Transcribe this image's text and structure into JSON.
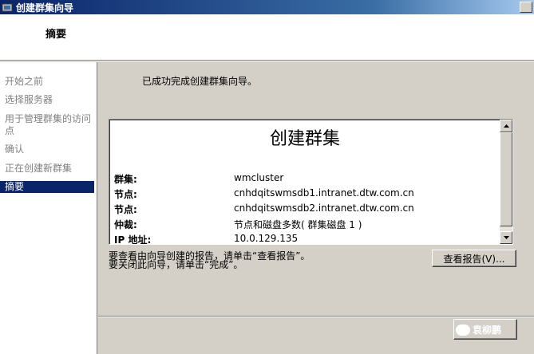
{
  "window": {
    "title": "创建群集向导"
  },
  "header": {
    "title": "摘要"
  },
  "sidebar": {
    "items": [
      {
        "label": "开始之前",
        "active": false
      },
      {
        "label": "选择服务器",
        "active": false
      },
      {
        "label": "用于管理群集的访问点",
        "active": false
      },
      {
        "label": "确认",
        "active": false
      },
      {
        "label": "正在创建新群集",
        "active": false
      },
      {
        "label": "摘要",
        "active": true
      }
    ]
  },
  "main": {
    "success_message": "已成功完成创建群集向导。",
    "report": {
      "title": "创建群集",
      "rows": [
        {
          "label": "群集:",
          "value": "wmcluster"
        },
        {
          "label": "节点:",
          "value": "cnhdqitswmsdb1.intranet.dtw.com.cn"
        },
        {
          "label": "节点:",
          "value": "cnhdqitswmsdb2.intranet.dtw.com.cn"
        },
        {
          "label": "仲裁:",
          "value": "节点和磁盘多数( 群集磁盘 1 )"
        },
        {
          "label": "IP 地址:",
          "value": "10.0.129.135"
        }
      ]
    },
    "hint_line1": "要查看由向导创建的报告，请单击“查看报告”。",
    "hint_line2": "要关闭此向导，请单击“完成”。",
    "view_report_label": "查看报告(V)...",
    "watermark_text": "袁柳鹏"
  },
  "colors": {
    "titlebar": "#0a246a",
    "selection": "#0a246a",
    "dialog_bg": "#d4d0c8"
  }
}
